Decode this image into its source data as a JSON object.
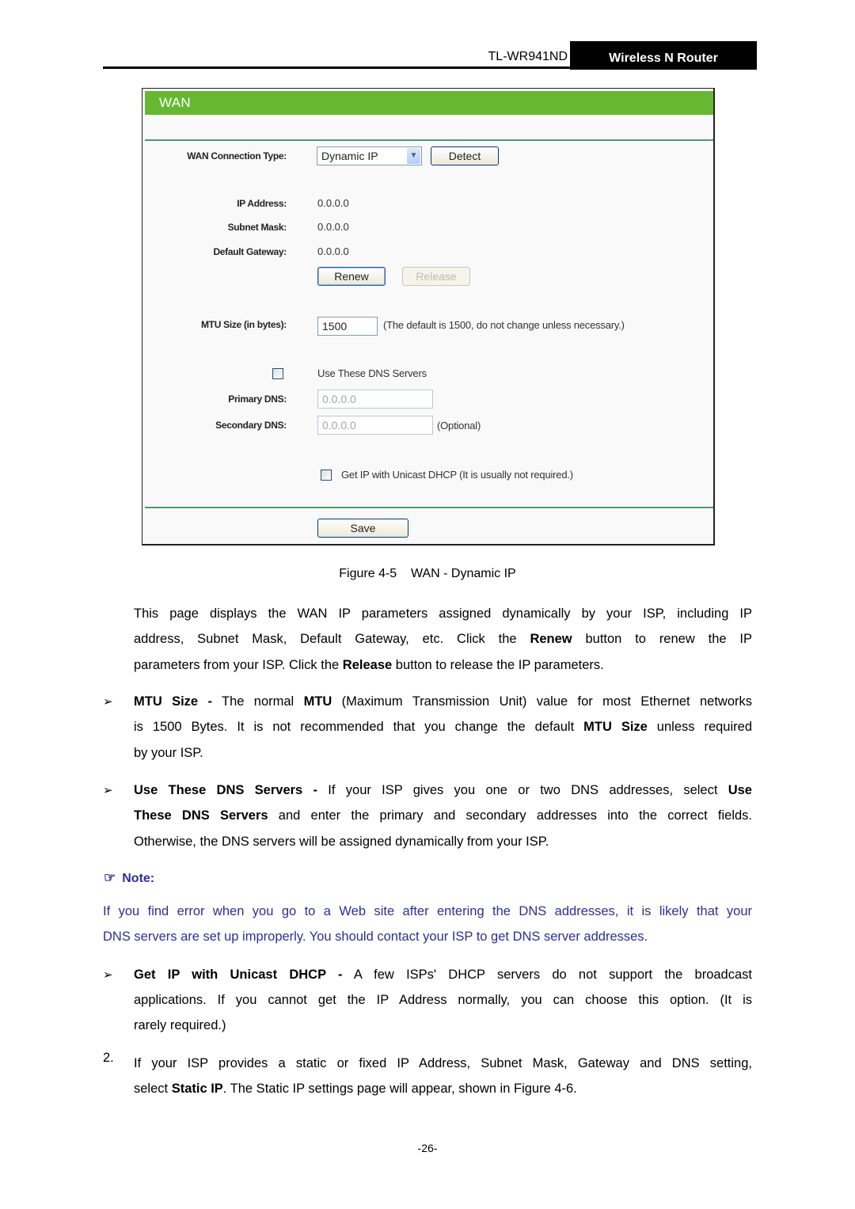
{
  "header": {
    "model": "TL-WR941ND",
    "product": "Wireless N Router"
  },
  "panel": {
    "title": "WAN",
    "wan_type_label": "WAN Connection Type:",
    "wan_type_value": "Dynamic IP",
    "detect_button": "Detect",
    "ip_label": "IP Address:",
    "ip_value": "0.0.0.0",
    "mask_label": "Subnet Mask:",
    "mask_value": "0.0.0.0",
    "gateway_label": "Default Gateway:",
    "gateway_value": "0.0.0.0",
    "renew_button": "Renew",
    "release_button": "Release",
    "mtu_label": "MTU Size (in bytes):",
    "mtu_value": "1500",
    "mtu_hint": "(The default is 1500, do not change unless necessary.)",
    "use_dns_label": "Use These DNS Servers",
    "use_dns_checked": false,
    "primary_dns_label": "Primary DNS:",
    "primary_dns_value": "0.0.0.0",
    "secondary_dns_label": "Secondary DNS:",
    "secondary_dns_value": "0.0.0.0",
    "optional_hint": "(Optional)",
    "unicast_label": "Get IP with Unicast DHCP (It is usually not required.)",
    "unicast_checked": false,
    "save_button": "Save"
  },
  "caption": "Figure 4-5    WAN - Dynamic IP",
  "intro": {
    "p1": "This page displays the WAN IP parameters assigned dynamically by your ISP, including IP",
    "p2a": "address, Subnet Mask, Default Gateway, etc. Click the ",
    "p2b": "Renew",
    "p2c": " button to renew the IP",
    "p3a": "parameters from your ISP. Click the ",
    "p3b": "Release",
    "p3c": " button to release the IP parameters."
  },
  "bullets": {
    "symbol": "➢",
    "mtu": {
      "l1a": "MTU Size -",
      "l1b": " The normal ",
      "l1c": "MTU",
      "l1d": " (Maximum Transmission Unit) value for most Ethernet networks",
      "l2a": "is 1500 Bytes. It is not recommended that you change the default ",
      "l2b": "MTU Size",
      "l2c": " unless required",
      "l3": "by your ISP."
    },
    "dns": {
      "l1a": "Use These DNS Servers -",
      "l1b": " If your ISP gives you one or two DNS addresses, select ",
      "l1c": "Use",
      "l2a": "These DNS Servers",
      "l2b": " and enter the primary and secondary addresses into the correct fields.",
      "l3": "Otherwise, the DNS servers will be assigned dynamically from your ISP."
    },
    "unicast": {
      "l1a": "Get IP with Unicast DHCP -",
      "l1b": " A few ISPs' DHCP servers do not support the broadcast",
      "l2": "applications. If you cannot get the IP Address normally, you can choose this option. (It is",
      "l3": "rarely required.)"
    }
  },
  "note": {
    "icon": "☞",
    "title": "Note:",
    "l1": "If you find error when you go to a Web site after entering the DNS addresses, it is likely that your",
    "l2": "DNS servers are set up improperly. You should contact your ISP to get DNS server addresses."
  },
  "step2": {
    "number": "2.",
    "l1": "If your ISP provides a static or fixed IP Address, Subnet Mask, Gateway and DNS setting,",
    "l2a": "select ",
    "l2b": "Static IP",
    "l2c": ". The Static IP settings page will appear, shown in Figure 4-6."
  },
  "page_number": "-26-",
  "colors": {
    "panel_title_green": "#66b832",
    "note_blue": "#2b2f99"
  }
}
